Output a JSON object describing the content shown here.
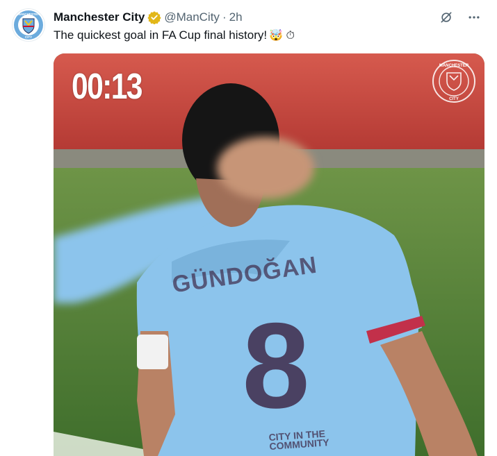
{
  "tweet": {
    "author_name": "Manchester City",
    "handle": "@ManCity",
    "separator": "·",
    "time": "2h",
    "text": "The quickest goal in FA Cup final history!",
    "emojis": "🤯 ⏱",
    "verified_color": "#e2b719"
  },
  "avatar": {
    "badge_text": "MANCHESTER",
    "badge_bottom": "CITY"
  },
  "media": {
    "timer": "00:13",
    "watermark_text": "MANCHESTER",
    "watermark_bottom": "CITY",
    "shirt_name": "GÜNDOĞAN",
    "shirt_number": "8",
    "shirt_sponsor": "CITY IN THE COMMUNITY",
    "colors": {
      "shirt": "#8cc4ec",
      "pitch": "#4d7a3a",
      "stand": "#c8453f",
      "number": "#3f2b4a"
    }
  },
  "actions": {
    "grok_icon": "grok-icon",
    "more_icon": "more-icon"
  }
}
